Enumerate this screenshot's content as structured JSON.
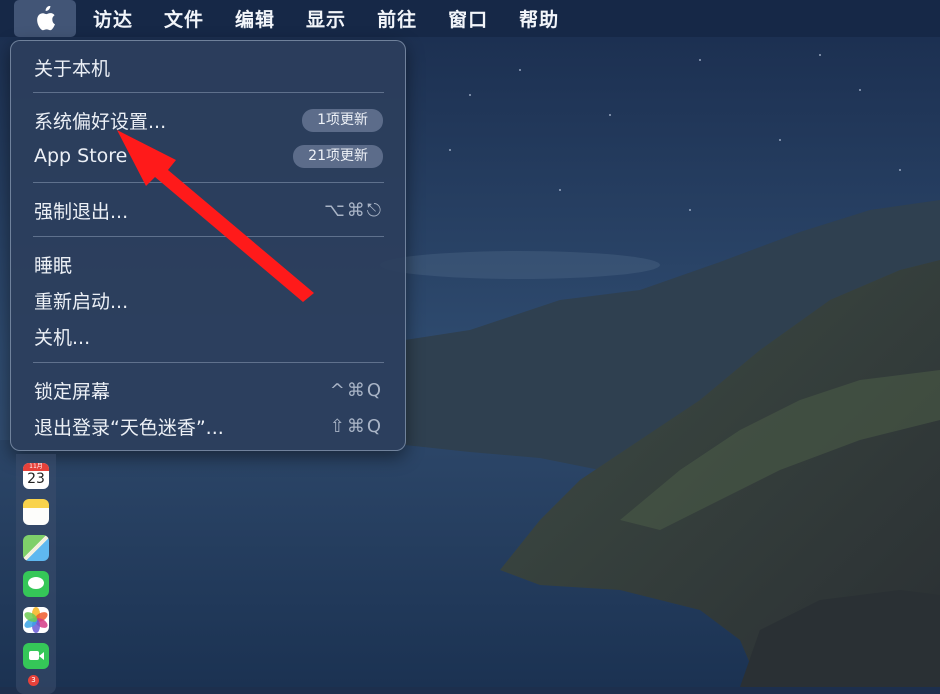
{
  "menubar": {
    "apple_icon": "apple-logo-icon",
    "items": [
      "访达",
      "文件",
      "编辑",
      "显示",
      "前往",
      "窗口",
      "帮助"
    ]
  },
  "apple_menu": {
    "about": "关于本机",
    "system_prefs": {
      "label": "系统偏好设置...",
      "badge": "1项更新"
    },
    "app_store": {
      "label": "App Store",
      "badge": "21项更新"
    },
    "force_quit": {
      "label": "强制退出...",
      "shortcut": "⌥⌘⎋"
    },
    "sleep": "睡眠",
    "restart": "重新启动...",
    "shutdown": "关机...",
    "lock_screen": {
      "label": "锁定屏幕",
      "shortcut": "^⌘Q"
    },
    "logout": {
      "label": "退出登录“天色迷香”...",
      "shortcut": "⇧⌘Q"
    }
  },
  "dock": {
    "calendar": {
      "month": "11月",
      "day": "23"
    },
    "icons": [
      "calendar-icon",
      "notes-icon",
      "maps-icon",
      "messages-icon",
      "photos-icon",
      "facetime-icon"
    ],
    "badge": "3"
  },
  "annotation": {
    "arrow_color": "#ff1a1a"
  },
  "colors": {
    "menu_background": "#2c3e5c",
    "menubar_background": "#162846"
  }
}
